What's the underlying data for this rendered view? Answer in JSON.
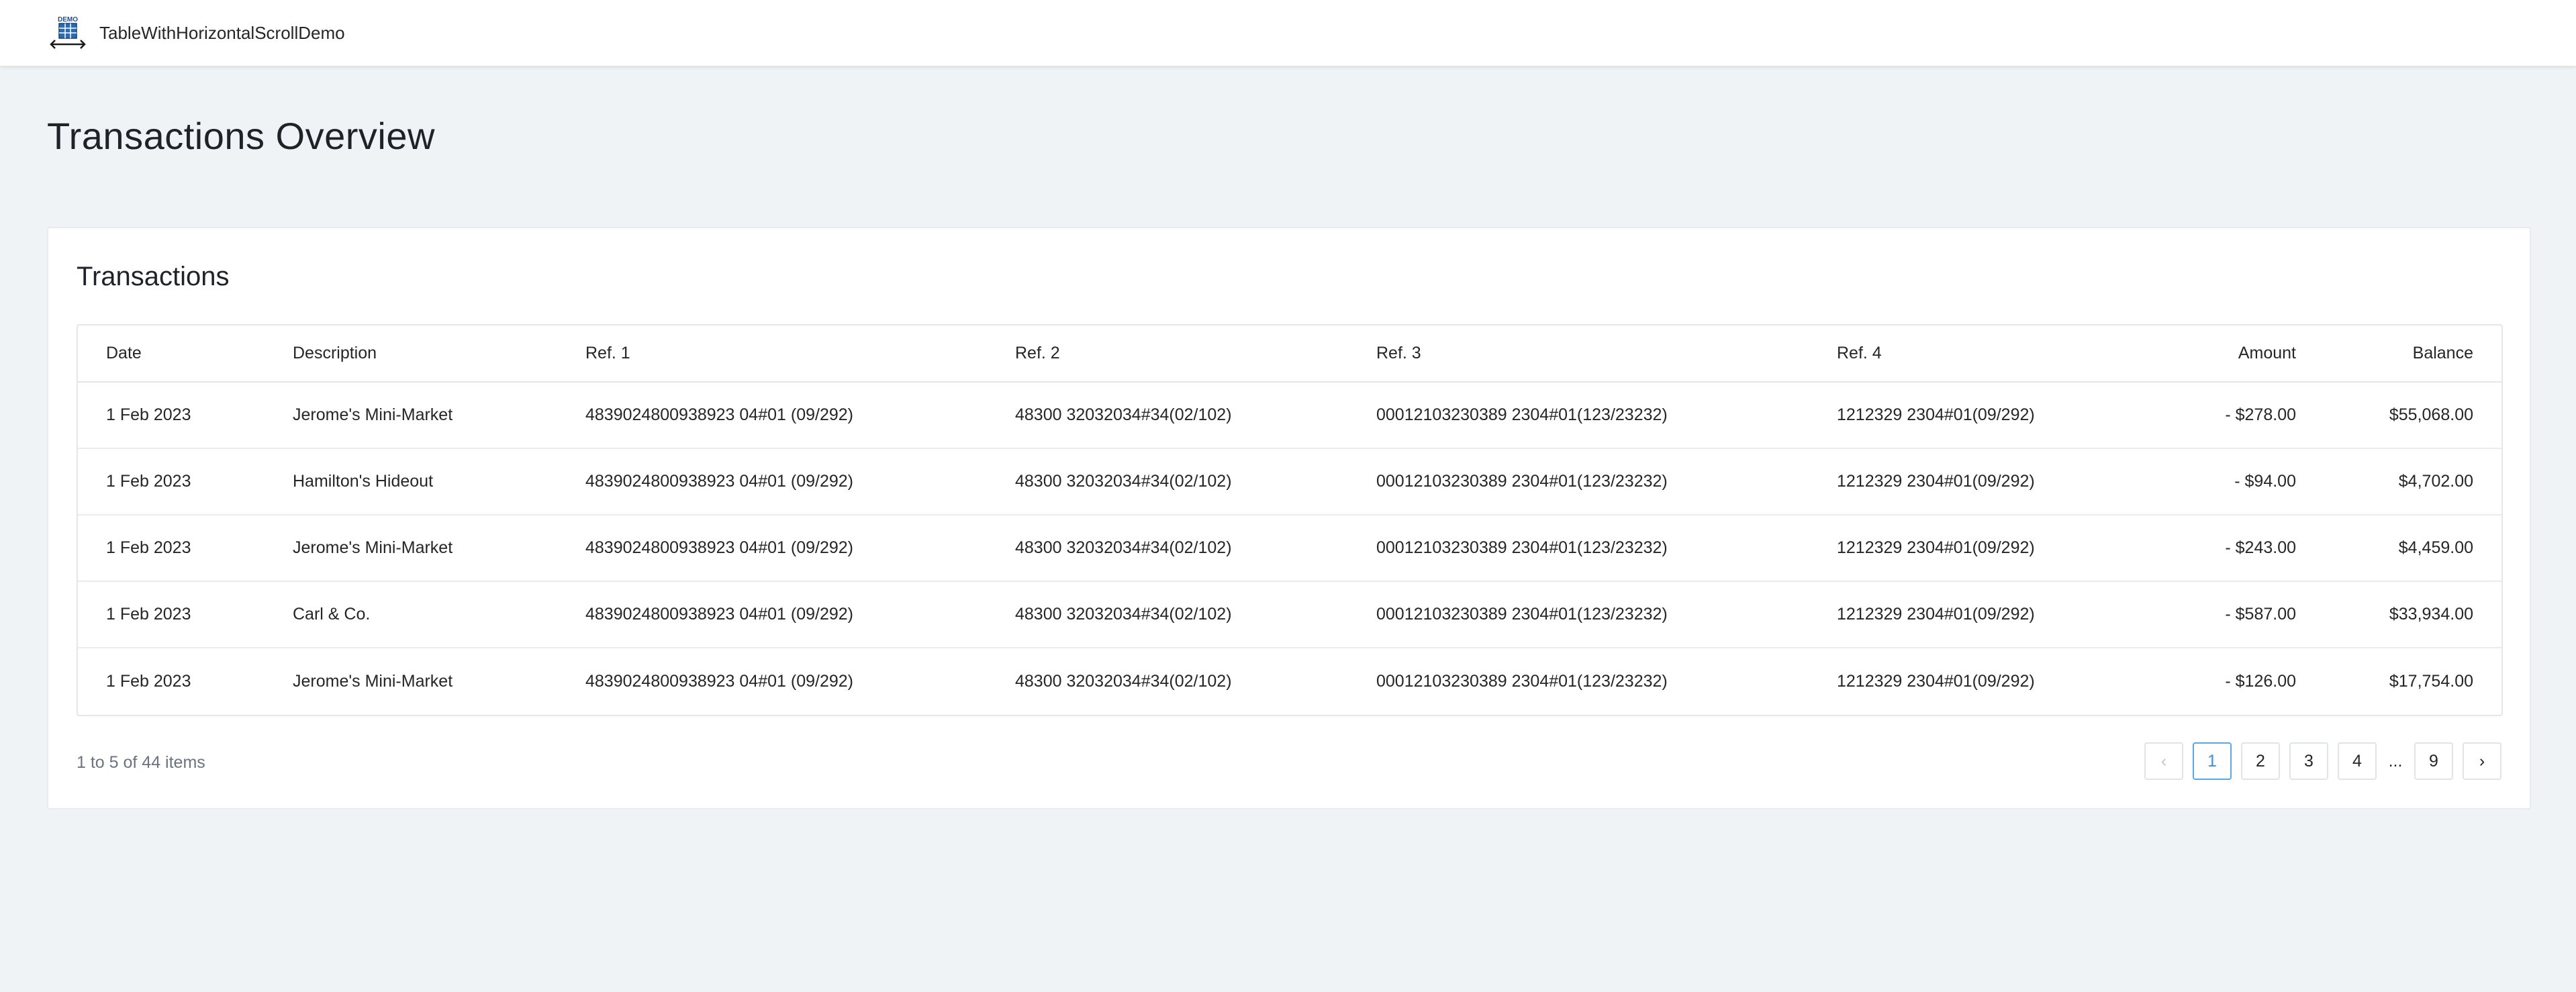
{
  "header": {
    "logo_text": "DEMO",
    "app_name": "TableWithHorizontalScrollDemo"
  },
  "page": {
    "title": "Transactions Overview"
  },
  "card": {
    "title": "Transactions"
  },
  "table": {
    "columns": {
      "date": "Date",
      "description": "Description",
      "ref1": "Ref. 1",
      "ref2": "Ref. 2",
      "ref3": "Ref. 3",
      "ref4": "Ref. 4",
      "amount": "Amount",
      "balance": "Balance"
    },
    "rows": [
      {
        "date": "1 Feb 2023",
        "description": "Jerome's Mini-Market",
        "ref1": "4839024800938923 04#01 (09/292)",
        "ref2": "48300 32032034#34(02/102)",
        "ref3": "00012103230389 2304#01(123/23232)",
        "ref4": "1212329 2304#01(09/292)",
        "amount": "- $278.00",
        "balance": "$55,068.00"
      },
      {
        "date": "1 Feb 2023",
        "description": "Hamilton's Hideout",
        "ref1": "4839024800938923 04#01 (09/292)",
        "ref2": "48300 32032034#34(02/102)",
        "ref3": "00012103230389 2304#01(123/23232)",
        "ref4": "1212329 2304#01(09/292)",
        "amount": "- $94.00",
        "balance": "$4,702.00"
      },
      {
        "date": "1 Feb 2023",
        "description": "Jerome's Mini-Market",
        "ref1": "4839024800938923 04#01 (09/292)",
        "ref2": "48300 32032034#34(02/102)",
        "ref3": "00012103230389 2304#01(123/23232)",
        "ref4": "1212329 2304#01(09/292)",
        "amount": "- $243.00",
        "balance": "$4,459.00"
      },
      {
        "date": "1 Feb 2023",
        "description": "Carl & Co.",
        "ref1": "4839024800938923 04#01 (09/292)",
        "ref2": "48300 32032034#34(02/102)",
        "ref3": "00012103230389 2304#01(123/23232)",
        "ref4": "1212329 2304#01(09/292)",
        "amount": "- $587.00",
        "balance": "$33,934.00"
      },
      {
        "date": "1 Feb 2023",
        "description": "Jerome's Mini-Market",
        "ref1": "4839024800938923 04#01 (09/292)",
        "ref2": "48300 32032034#34(02/102)",
        "ref3": "00012103230389 2304#01(123/23232)",
        "ref4": "1212329 2304#01(09/292)",
        "amount": "- $126.00",
        "balance": "$17,754.00"
      }
    ]
  },
  "pagination": {
    "summary": "1 to 5 of 44 items",
    "prev_icon": "chevron-left-icon",
    "next_icon": "chevron-right-icon",
    "prev_glyph": "‹",
    "next_glyph": "›",
    "pages": [
      "1",
      "2",
      "3",
      "4"
    ],
    "ellipsis": "...",
    "last_page": "9",
    "current_page": "1",
    "accent_color": "#3d8fd6"
  }
}
